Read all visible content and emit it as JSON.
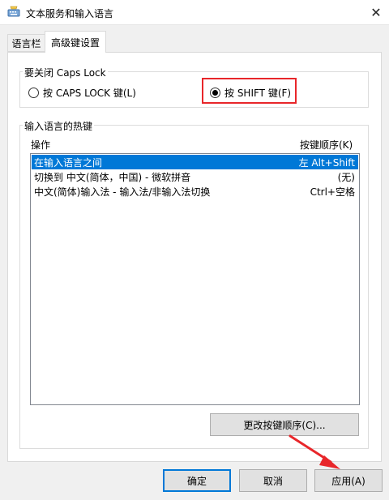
{
  "window": {
    "title": "文本服务和输入语言",
    "close_glyph": "✕"
  },
  "tabs": [
    {
      "label": "语言栏",
      "selected": false
    },
    {
      "label": "高级键设置",
      "selected": true
    }
  ],
  "caps_lock": {
    "group_label": "要关闭 Caps Lock",
    "options": [
      {
        "label": "按 CAPS LOCK 键(L)",
        "checked": false
      },
      {
        "label": "按 SHIFT 键(F)",
        "checked": true
      }
    ]
  },
  "hotkeys": {
    "group_label": "输入语言的热键",
    "columns": {
      "action": "操作",
      "sequence": "按键顺序(K)"
    },
    "rows": [
      {
        "action": "在输入语言之间",
        "sequence": "左 Alt+Shift",
        "selected": true
      },
      {
        "action": "切换到 中文(简体，中国) - 微软拼音",
        "sequence": "(无)",
        "selected": false
      },
      {
        "action": "中文(简体)输入法 - 输入法/非输入法切换",
        "sequence": "Ctrl+空格",
        "selected": false
      }
    ],
    "change_button": "更改按键顺序(C)..."
  },
  "buttons": {
    "ok": "确定",
    "cancel": "取消",
    "apply": "应用(A)"
  },
  "colors": {
    "selection": "#0078d7",
    "annotation": "#e8262a"
  },
  "icons": {
    "app": "keyboard-icon",
    "close": "close-icon"
  }
}
